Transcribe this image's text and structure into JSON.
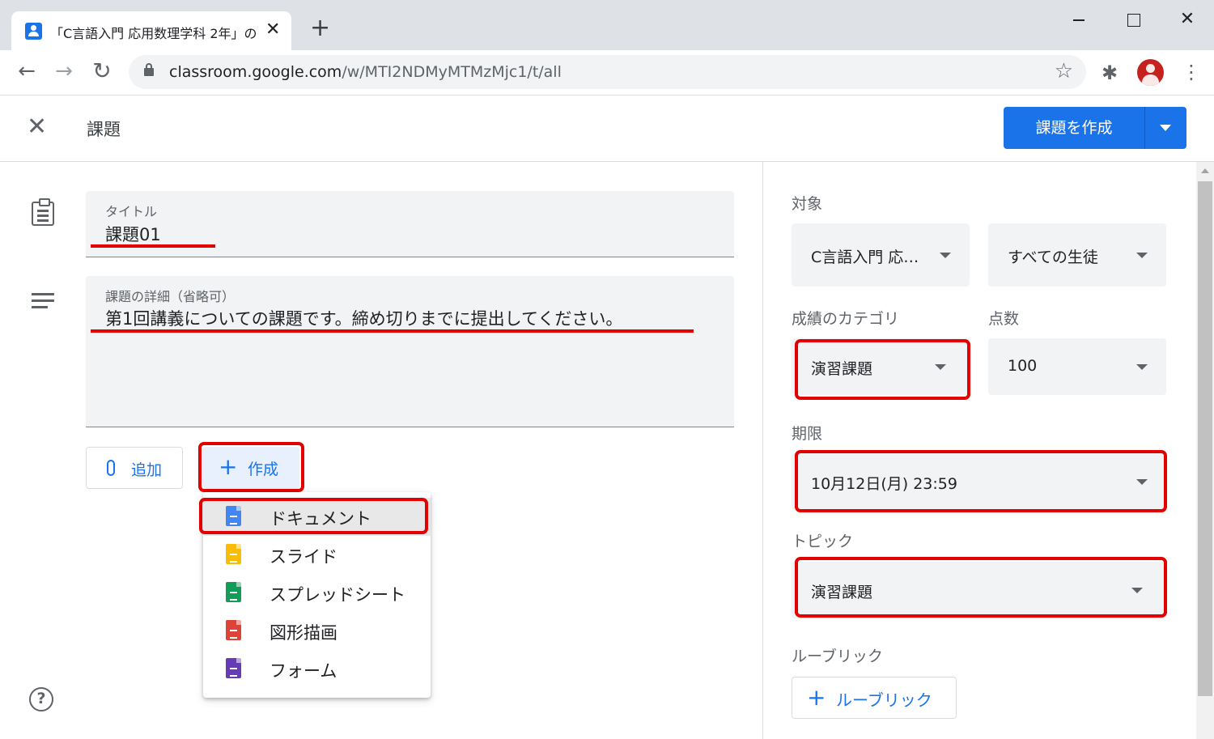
{
  "browser": {
    "tab_title": "「C言語入門 応用数理学科 2年」の",
    "tab_close": "✕",
    "new_tab": "+",
    "url_host": "classroom.google.com",
    "url_path": "/w/MTI2NDMyMTMzMjc1/t/all",
    "icons": [
      "back-icon",
      "forward-icon",
      "reload-icon",
      "lock-icon",
      "star-icon",
      "extensions-icon",
      "profile-avatar",
      "more-vert-icon",
      "minimize-icon",
      "maximize-icon",
      "window-close-icon"
    ]
  },
  "header": {
    "close_icon": "✕",
    "title": "課題",
    "create_button": "課題を作成",
    "accent": "#1a73e8"
  },
  "form": {
    "title_label": "タイトル",
    "title_value": "課題01",
    "details_label": "課題の詳細（省略可）",
    "details_value": "第1回講義についての課題です。締め切りまでに提出してください。",
    "add_button": "追加",
    "create_button": "作成",
    "create_menu": [
      {
        "label": "ドキュメント",
        "icon": "docs-icon",
        "color": "#4285f4"
      },
      {
        "label": "スライド",
        "icon": "slides-icon",
        "color": "#fbbc04"
      },
      {
        "label": "スプレッドシート",
        "icon": "sheets-icon",
        "color": "#0f9d58"
      },
      {
        "label": "図形描画",
        "icon": "drawings-icon",
        "color": "#db4437"
      },
      {
        "label": "フォーム",
        "icon": "forms-icon",
        "color": "#673ab7"
      }
    ],
    "highlight_color": "#e30000"
  },
  "settings": {
    "for_label": "対象",
    "class_select": "C言語入門 応…",
    "students_select": "すべての生徒",
    "grade_category_label": "成績のカテゴリ",
    "grade_category_value": "演習課題",
    "points_label": "点数",
    "points_value": "100",
    "due_label": "期限",
    "due_value": "10月12日(月) 23:59",
    "topic_label": "トピック",
    "topic_value": "演習課題",
    "rubric_label": "ルーブリック",
    "rubric_button": "ルーブリック"
  }
}
